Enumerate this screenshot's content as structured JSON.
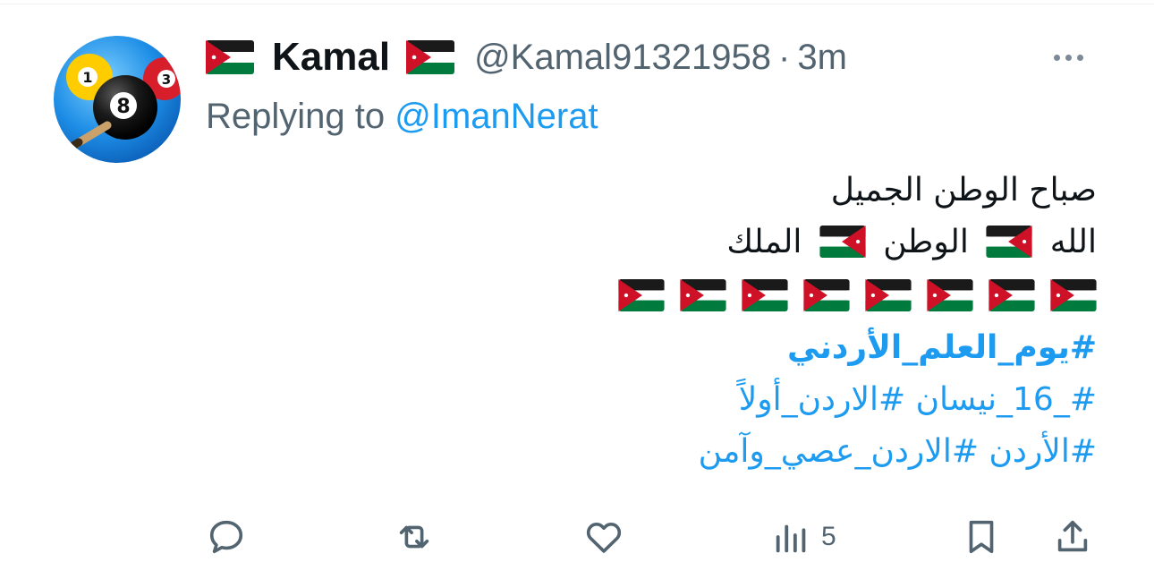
{
  "tweet": {
    "author": {
      "display_name": "Kamal",
      "handle": "@Kamal91321958",
      "avatar_icon": "eight-ball-billiards-avatar",
      "name_flag_icon": "jordan-flag-icon"
    },
    "separator": "·",
    "time": "3m",
    "reply_prefix": "Replying to",
    "reply_to": "@ImanNerat",
    "body": {
      "line1": "صباح الوطن الجميل",
      "line2_part1": "الله",
      "line2_part2": "الوطن",
      "line2_part3": "الملك",
      "flag_row_count": 8,
      "hashtag1": "#يوم_العلم_الأردني",
      "hashtag_line2": "#_16_نيسان #الاردن_أولاً",
      "hashtag_line3": "#الأردن #الاردن_عصي_وآمن"
    },
    "actions": {
      "views_count": "5"
    },
    "colors": {
      "link": "#1d9bf0",
      "secondary_text": "#536471",
      "primary_text": "#0f1419",
      "icon": "#536471"
    }
  }
}
